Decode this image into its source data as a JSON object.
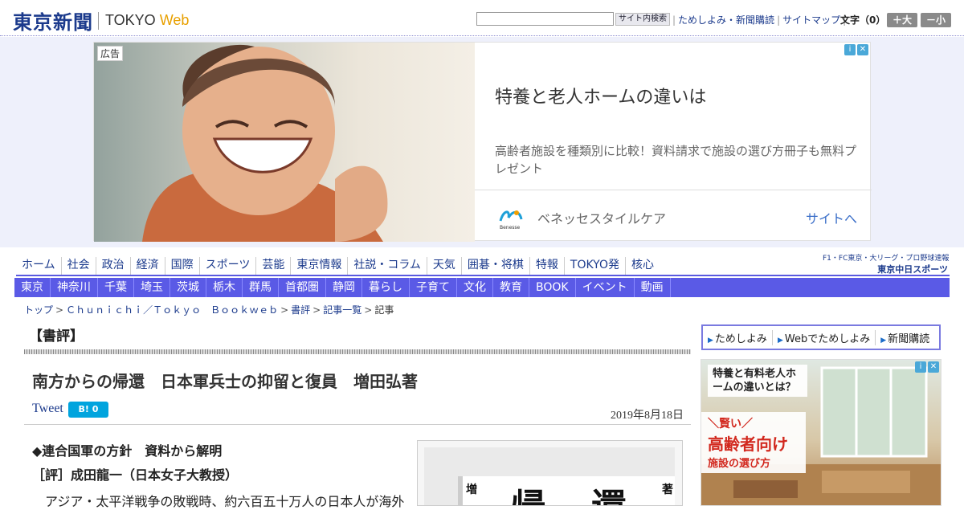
{
  "header": {
    "logo_jp": "東京新聞",
    "logo_en": "TOKYO",
    "logo_web": "Web",
    "search_button": "サイト内検索",
    "links": [
      "ためしよみ・新聞購読",
      "サイトマップ"
    ],
    "font_size_label": "文字（0）",
    "font_larger": "＋大",
    "font_smaller": "－小"
  },
  "top_ad": {
    "label": "広告",
    "title": "特養と老人ホームの違いは",
    "description": "高齢者施設を種類別に比較！資料請求で施設の選び方冊子も無料プレゼント",
    "brand": "ベネッセスタイルケア",
    "brand_logo_text": "Benesse",
    "cta": "サイトへ",
    "adchoices": [
      "i",
      "✕"
    ]
  },
  "nav_primary": [
    "ホーム",
    "社会",
    "政治",
    "経済",
    "国際",
    "スポーツ",
    "芸能",
    "東京情報",
    "社説・コラム",
    "天気",
    "囲碁・将棋",
    "特報",
    "TOKYO発",
    "核心"
  ],
  "chunichi": {
    "small": "F1・FC東京・大リーグ・プロ野球速報",
    "big": "東京中日スポーツ"
  },
  "nav_secondary": [
    "東京",
    "神奈川",
    "千葉",
    "埼玉",
    "茨城",
    "栃木",
    "群馬",
    "首都圏",
    "静岡",
    "暮らし",
    "子育て",
    "文化",
    "教育",
    "BOOK",
    "イベント",
    "動画"
  ],
  "breadcrumb": {
    "items": [
      "トップ",
      "Ｃｈｕｎｉｃｈｉ／Ｔｏｋｙｏ　Ｂｏｏｋｗｅｂ",
      "書評",
      "記事一覧"
    ],
    "current": "記事"
  },
  "article": {
    "section": "【書評】",
    "title": "南方からの帰還　日本軍兵士の抑留と復員　増田弘著",
    "tweet": "Tweet",
    "hatena": "B! 0",
    "date": "2019年8月18日",
    "subtitle": "◆連合国軍の方針　資料から解明",
    "reviewer": "［評］成田龍一（日本女子大教授）",
    "body_start": "アジア・太平洋戦争の敗戦時、約六百五十万人の日本人が海外",
    "book_chars": [
      "増",
      "帰",
      "還",
      "著"
    ]
  },
  "sidebar": {
    "links": [
      "ためしよみ",
      "Webでためしよみ",
      "新聞購読"
    ],
    "ad_text1": "特養と有料老人ホームの違いとは？",
    "ad_b1": "＼賢い／",
    "ad_b2": "高齢者向け",
    "ad_b3": "施設の選び方",
    "adchoices": [
      "i",
      "✕"
    ]
  }
}
